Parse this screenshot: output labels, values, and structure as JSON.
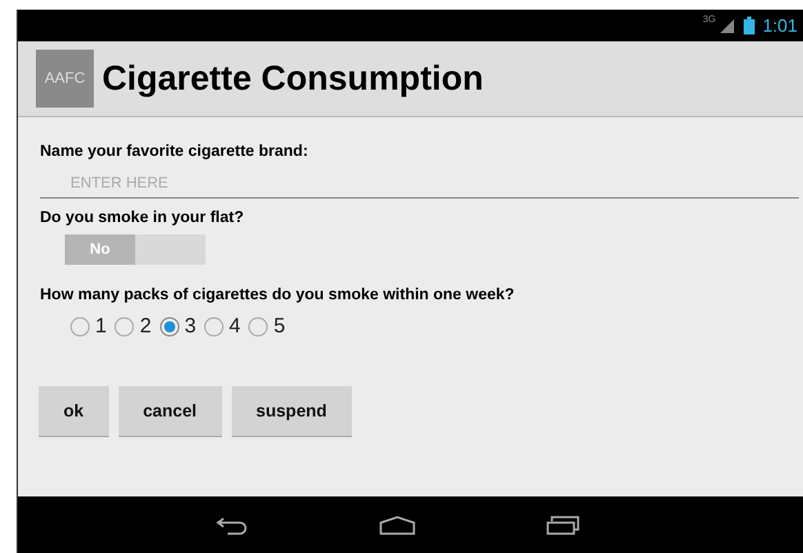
{
  "status_bar": {
    "network": "3G",
    "time": "1:01"
  },
  "action_bar": {
    "logo": "AAFC",
    "title": "Cigarette Consumption"
  },
  "questions": [
    {
      "kind": "text",
      "label": "Name your favorite cigarette brand:",
      "placeholder": "ENTER HERE"
    },
    {
      "kind": "toggle",
      "label": "Do you smoke in your flat?",
      "toggle_text": "No",
      "on": false
    },
    {
      "kind": "radio",
      "label": "How many packs of cigarettes do you smoke within one week?",
      "options": [
        {
          "label": "1",
          "selected": false
        },
        {
          "label": "2",
          "selected": false
        },
        {
          "label": "3",
          "selected": true
        },
        {
          "label": "4",
          "selected": false
        },
        {
          "label": "5",
          "selected": false
        }
      ]
    }
  ],
  "buttons": [
    "ok",
    "cancel",
    "suspend"
  ]
}
